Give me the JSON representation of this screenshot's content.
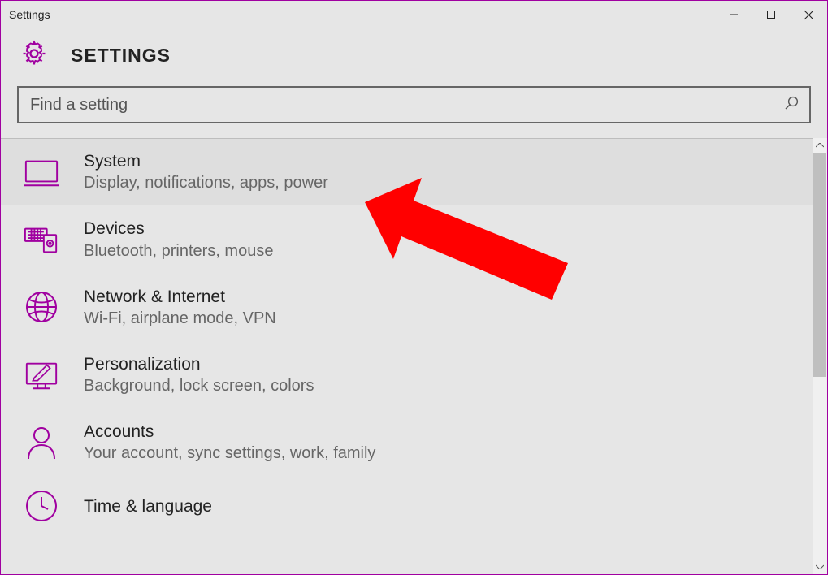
{
  "window": {
    "title": "Settings"
  },
  "header": {
    "app_title": "SETTINGS"
  },
  "search": {
    "placeholder": "Find a setting"
  },
  "accent_color": "#a000a0",
  "categories": [
    {
      "id": "system",
      "title": "System",
      "subtitle": "Display, notifications, apps, power",
      "icon": "monitor",
      "selected": true
    },
    {
      "id": "devices",
      "title": "Devices",
      "subtitle": "Bluetooth, printers, mouse",
      "icon": "devices",
      "selected": false
    },
    {
      "id": "network",
      "title": "Network & Internet",
      "subtitle": "Wi-Fi, airplane mode, VPN",
      "icon": "globe",
      "selected": false
    },
    {
      "id": "personalization",
      "title": "Personalization",
      "subtitle": "Background, lock screen, colors",
      "icon": "personalize",
      "selected": false
    },
    {
      "id": "accounts",
      "title": "Accounts",
      "subtitle": "Your account, sync settings, work, family",
      "icon": "person",
      "selected": false
    },
    {
      "id": "time-language",
      "title": "Time & language",
      "subtitle": "",
      "icon": "clock",
      "selected": false
    }
  ]
}
